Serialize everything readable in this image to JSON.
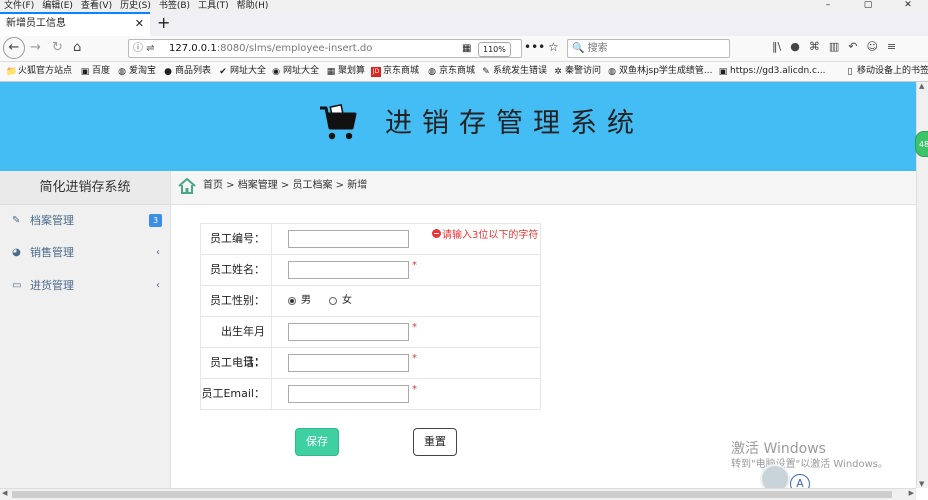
{
  "browser": {
    "menu": [
      "文件(F)",
      "编辑(E)",
      "查看(V)",
      "历史(S)",
      "书签(B)",
      "工具(T)",
      "帮助(H)"
    ],
    "window_controls": [
      "–",
      "▢",
      "✕"
    ],
    "tab_title": "新增员工信息",
    "tab_close": "✕",
    "new_tab": "+",
    "url_host": "127.0.0.1",
    "url_rest": ":8080/slms/employee-insert.do",
    "zoom": "110%",
    "page_actions": "•••",
    "search_placeholder": "🔍 搜索",
    "bookmarks": [
      {
        "icon": "📁",
        "label": "火狐官方站点"
      },
      {
        "icon": "▣",
        "label": "百度"
      },
      {
        "icon": "◍",
        "label": "爱淘宝"
      },
      {
        "icon": "●",
        "label": "商品列表"
      },
      {
        "icon": "✔",
        "label": "网址大全"
      },
      {
        "icon": "◉",
        "label": "网址大全"
      },
      {
        "icon": "▦",
        "label": "聚划算"
      },
      {
        "icon": "JD",
        "label": "京东商城"
      },
      {
        "icon": "◍",
        "label": "京东商城"
      },
      {
        "icon": "✎",
        "label": "系统发生错误"
      },
      {
        "icon": "✲",
        "label": "秦警访问"
      },
      {
        "icon": "◍",
        "label": "双鱼林jsp学生成绩管..."
      },
      {
        "icon": "▣",
        "label": "https://gd3.alicdn.c..."
      },
      {
        "icon": "▯",
        "label": "移动设备上的书签"
      }
    ],
    "side_badge": "48"
  },
  "app": {
    "system_name": "进销存管理系统",
    "sidebar_title": "简化进销存系统",
    "sidebar_items": [
      {
        "label": "档案管理",
        "badge": "3"
      },
      {
        "label": "销售管理",
        "chevron": "‹"
      },
      {
        "label": "进货管理",
        "chevron": "‹"
      }
    ],
    "breadcrumb": "首页 > 档案管理 > 员工档案 > 新增"
  },
  "form": {
    "id_label": "员工编号：",
    "id_value": "",
    "id_error": "请输入3位以下的字符",
    "name_label": "员工姓名：",
    "name_value": "",
    "gender_label": "员工性别：",
    "gender_male": "男",
    "gender_female": "女",
    "gender_selected": "男",
    "birth_label": "出生年月日：",
    "birth_value": "",
    "phone_label": "员工电话：",
    "phone_value": "",
    "email_label": "员工Email：",
    "email_value": "",
    "required_mark": "*",
    "save_label": "保存",
    "reset_label": "重置"
  },
  "watermark": {
    "line1": "激活 Windows",
    "line2": "转到\"电脑设置\"以激活 Windows。"
  },
  "tray_badge": "A",
  "colors": {
    "banner": "#44bcf4",
    "save_button": "#3fd0a1",
    "error": "#e33333",
    "badge": "#3a8ee6"
  }
}
